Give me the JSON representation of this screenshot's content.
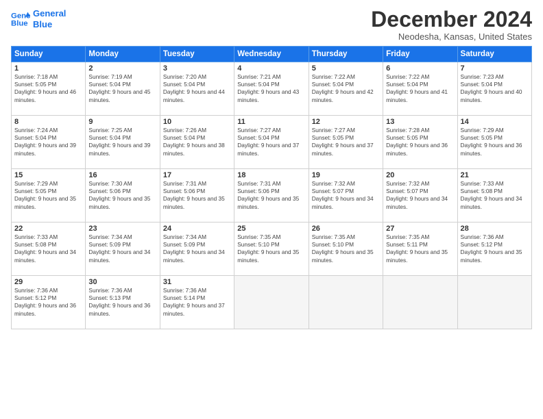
{
  "header": {
    "logo_line1": "General",
    "logo_line2": "Blue",
    "month_title": "December 2024",
    "location": "Neodesha, Kansas, United States"
  },
  "weekdays": [
    "Sunday",
    "Monday",
    "Tuesday",
    "Wednesday",
    "Thursday",
    "Friday",
    "Saturday"
  ],
  "weeks": [
    [
      {
        "day": "1",
        "sunrise": "7:18 AM",
        "sunset": "5:05 PM",
        "daylight": "9 hours and 46 minutes."
      },
      {
        "day": "2",
        "sunrise": "7:19 AM",
        "sunset": "5:04 PM",
        "daylight": "9 hours and 45 minutes."
      },
      {
        "day": "3",
        "sunrise": "7:20 AM",
        "sunset": "5:04 PM",
        "daylight": "9 hours and 44 minutes."
      },
      {
        "day": "4",
        "sunrise": "7:21 AM",
        "sunset": "5:04 PM",
        "daylight": "9 hours and 43 minutes."
      },
      {
        "day": "5",
        "sunrise": "7:22 AM",
        "sunset": "5:04 PM",
        "daylight": "9 hours and 42 minutes."
      },
      {
        "day": "6",
        "sunrise": "7:22 AM",
        "sunset": "5:04 PM",
        "daylight": "9 hours and 41 minutes."
      },
      {
        "day": "7",
        "sunrise": "7:23 AM",
        "sunset": "5:04 PM",
        "daylight": "9 hours and 40 minutes."
      }
    ],
    [
      {
        "day": "8",
        "sunrise": "7:24 AM",
        "sunset": "5:04 PM",
        "daylight": "9 hours and 39 minutes."
      },
      {
        "day": "9",
        "sunrise": "7:25 AM",
        "sunset": "5:04 PM",
        "daylight": "9 hours and 39 minutes."
      },
      {
        "day": "10",
        "sunrise": "7:26 AM",
        "sunset": "5:04 PM",
        "daylight": "9 hours and 38 minutes."
      },
      {
        "day": "11",
        "sunrise": "7:27 AM",
        "sunset": "5:04 PM",
        "daylight": "9 hours and 37 minutes."
      },
      {
        "day": "12",
        "sunrise": "7:27 AM",
        "sunset": "5:05 PM",
        "daylight": "9 hours and 37 minutes."
      },
      {
        "day": "13",
        "sunrise": "7:28 AM",
        "sunset": "5:05 PM",
        "daylight": "9 hours and 36 minutes."
      },
      {
        "day": "14",
        "sunrise": "7:29 AM",
        "sunset": "5:05 PM",
        "daylight": "9 hours and 36 minutes."
      }
    ],
    [
      {
        "day": "15",
        "sunrise": "7:29 AM",
        "sunset": "5:05 PM",
        "daylight": "9 hours and 35 minutes."
      },
      {
        "day": "16",
        "sunrise": "7:30 AM",
        "sunset": "5:06 PM",
        "daylight": "9 hours and 35 minutes."
      },
      {
        "day": "17",
        "sunrise": "7:31 AM",
        "sunset": "5:06 PM",
        "daylight": "9 hours and 35 minutes."
      },
      {
        "day": "18",
        "sunrise": "7:31 AM",
        "sunset": "5:06 PM",
        "daylight": "9 hours and 35 minutes."
      },
      {
        "day": "19",
        "sunrise": "7:32 AM",
        "sunset": "5:07 PM",
        "daylight": "9 hours and 34 minutes."
      },
      {
        "day": "20",
        "sunrise": "7:32 AM",
        "sunset": "5:07 PM",
        "daylight": "9 hours and 34 minutes."
      },
      {
        "day": "21",
        "sunrise": "7:33 AM",
        "sunset": "5:08 PM",
        "daylight": "9 hours and 34 minutes."
      }
    ],
    [
      {
        "day": "22",
        "sunrise": "7:33 AM",
        "sunset": "5:08 PM",
        "daylight": "9 hours and 34 minutes."
      },
      {
        "day": "23",
        "sunrise": "7:34 AM",
        "sunset": "5:09 PM",
        "daylight": "9 hours and 34 minutes."
      },
      {
        "day": "24",
        "sunrise": "7:34 AM",
        "sunset": "5:09 PM",
        "daylight": "9 hours and 34 minutes."
      },
      {
        "day": "25",
        "sunrise": "7:35 AM",
        "sunset": "5:10 PM",
        "daylight": "9 hours and 35 minutes."
      },
      {
        "day": "26",
        "sunrise": "7:35 AM",
        "sunset": "5:10 PM",
        "daylight": "9 hours and 35 minutes."
      },
      {
        "day": "27",
        "sunrise": "7:35 AM",
        "sunset": "5:11 PM",
        "daylight": "9 hours and 35 minutes."
      },
      {
        "day": "28",
        "sunrise": "7:36 AM",
        "sunset": "5:12 PM",
        "daylight": "9 hours and 35 minutes."
      }
    ],
    [
      {
        "day": "29",
        "sunrise": "7:36 AM",
        "sunset": "5:12 PM",
        "daylight": "9 hours and 36 minutes."
      },
      {
        "day": "30",
        "sunrise": "7:36 AM",
        "sunset": "5:13 PM",
        "daylight": "9 hours and 36 minutes."
      },
      {
        "day": "31",
        "sunrise": "7:36 AM",
        "sunset": "5:14 PM",
        "daylight": "9 hours and 37 minutes."
      },
      null,
      null,
      null,
      null
    ]
  ]
}
